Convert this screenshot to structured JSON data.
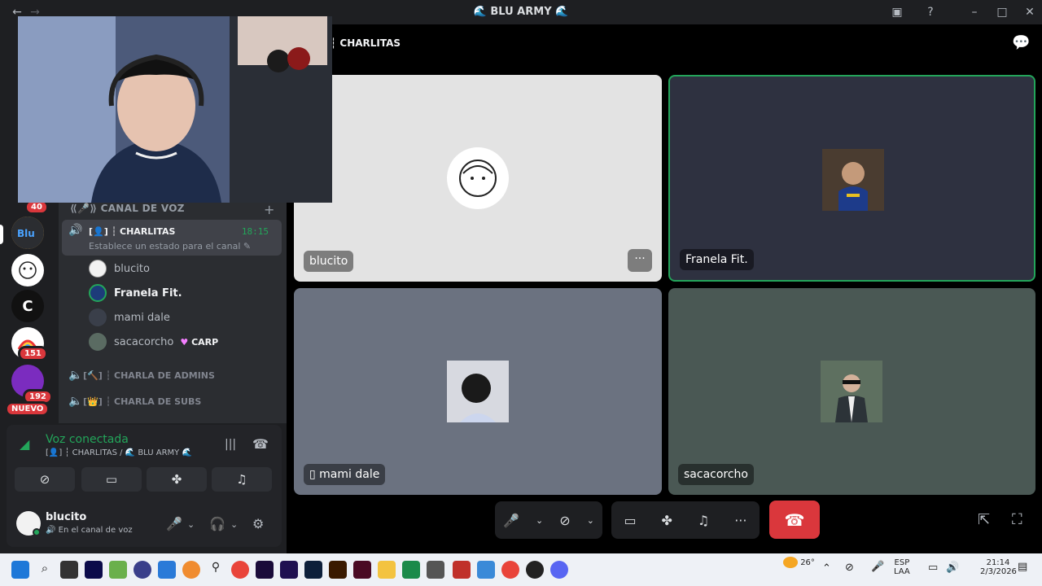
{
  "window": {
    "title": "🌊 BLU ARMY 🌊"
  },
  "server_badges": {
    "b1": "40",
    "b2": "151",
    "b3": "192",
    "new_label": "NUEVO"
  },
  "channels": {
    "category": "⟪🎤⟫ CANAL DE VOZ",
    "active": {
      "name": "[👤] ┆ CHARLITAS",
      "status_placeholder": "Establece un estado para el canal",
      "timer": "18:15"
    },
    "members": [
      {
        "name": "blucito",
        "bold": false
      },
      {
        "name": "Franela Fit.",
        "bold": true
      },
      {
        "name": "mami dale",
        "bold": false
      },
      {
        "name": "sacacorcho",
        "tag": "CARP"
      }
    ],
    "others": [
      {
        "name": "[🔨] ┆ CHARLA DE ADMINS"
      },
      {
        "name": "[👑] ┆ CHARLA DE SUBS"
      }
    ]
  },
  "voice": {
    "title": "Voz conectada",
    "subtitle": "[👤] ┆ CHARLITAS / 🌊 BLU ARMY 🌊"
  },
  "user": {
    "name": "blucito",
    "status": "En el canal de voz"
  },
  "stage": {
    "header": "┆ CHARLITAS",
    "tiles": [
      {
        "name": "blucito",
        "bg": "#e3e3e3"
      },
      {
        "name": "Franela Fit.",
        "bg": "#2e3140",
        "speaking_color": "#23a55a"
      },
      {
        "name": "mami dale",
        "bg": "#6b7280"
      },
      {
        "name": "sacacorcho",
        "bg": "#4a5854"
      }
    ]
  },
  "colors": {
    "online": "#23a55a",
    "danger": "#da373c"
  },
  "taskbar": {
    "weather": "26°",
    "lang1": "ESP",
    "lang2": "LAA",
    "time": "21:14",
    "date": "2/3/2026"
  }
}
